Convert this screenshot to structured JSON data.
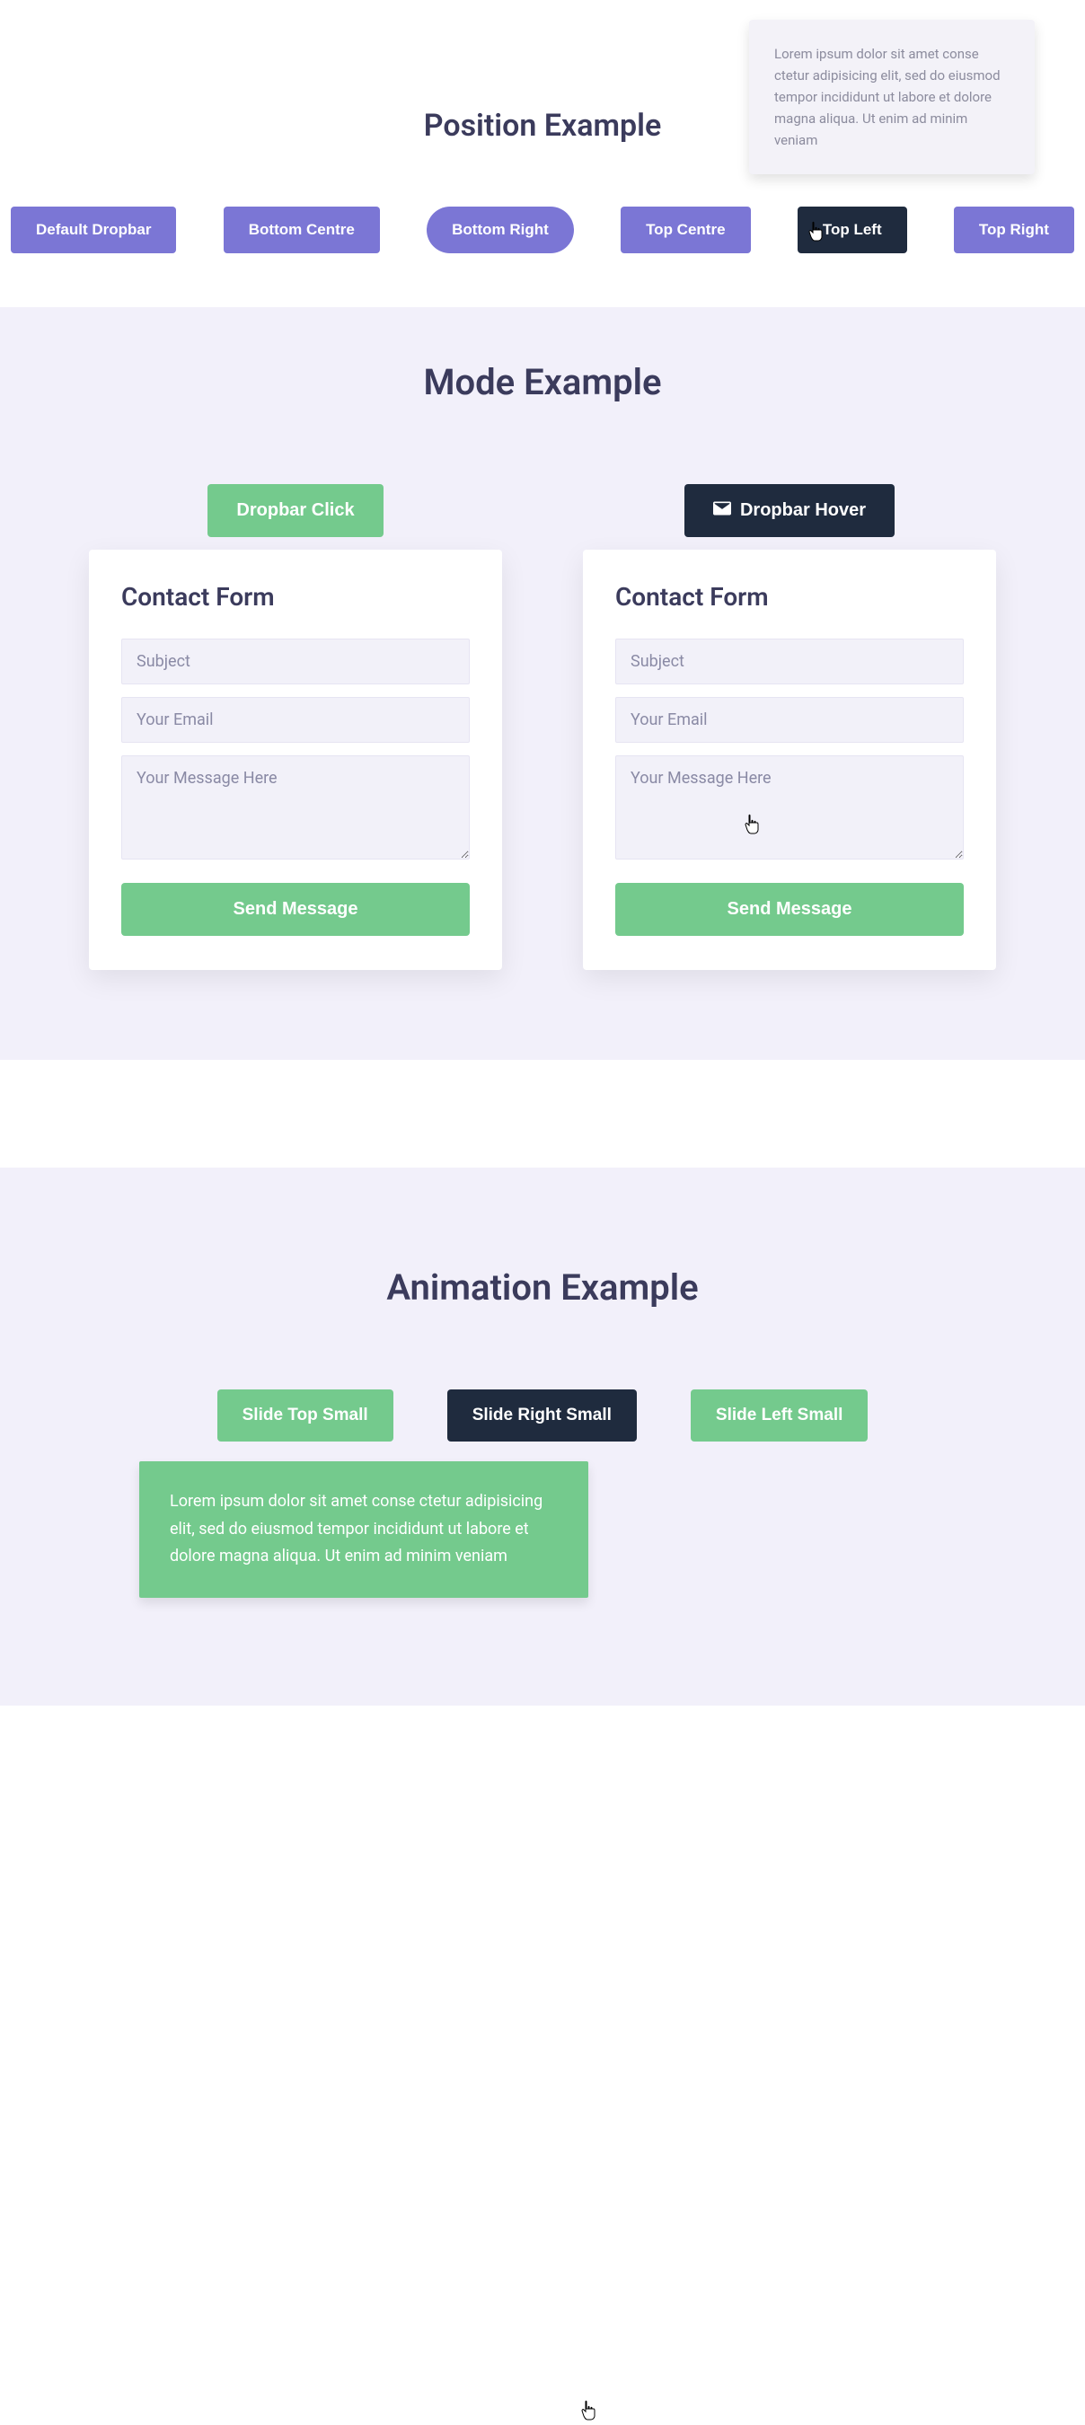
{
  "position": {
    "title": "Position Example",
    "buttons": {
      "default": "Default Dropbar",
      "bottom_centre": "Bottom Centre",
      "bottom_right": "Bottom Right",
      "top_centre": "Top Centre",
      "top_left": "Top Left",
      "top_right": "Top Right"
    },
    "tooltip_text": "Lorem ipsum dolor sit amet conse ctetur adipisicing elit, sed do eiusmod tempor incididunt ut labore et dolore magna aliqua. Ut enim ad minim veniam"
  },
  "mode": {
    "title": "Mode Example",
    "click_label": "Dropbar Click",
    "hover_label": "Dropbar Hover",
    "form": {
      "heading": "Contact Form",
      "subject_ph": "Subject",
      "email_ph": "Your Email",
      "message_ph": "Your Message Here",
      "send_label": "Send Message"
    }
  },
  "animation": {
    "title": "Animation Example",
    "buttons": {
      "slide_top": "Slide Top Small",
      "slide_right": "Slide Right Small",
      "slide_left": "Slide Left Small"
    },
    "panel_text": "Lorem ipsum dolor sit amet conse ctetur adipisicing elit, sed do eiusmod tempor incididunt ut labore et dolore magna aliqua. Ut enim ad minim veniam"
  },
  "colors": {
    "purple": "#7b76d5",
    "dark": "#1f2b3e",
    "green": "#74ca8d",
    "bg_light": "#f2f0fa"
  }
}
